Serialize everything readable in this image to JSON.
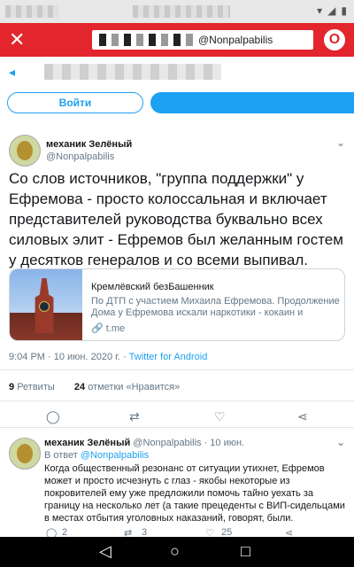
{
  "browser": {
    "url_visible": "@Nonpalpabilis",
    "close_icon": "close-icon",
    "menu_icon": "opera-icon"
  },
  "header": {
    "login_label": "Войти"
  },
  "tweet": {
    "author_name": "механик Зелёный",
    "author_handle": "@Nonpalpabilis",
    "text": "Со слов источников, \"группа поддержки\" у Ефремова  - просто колоссальная и включает представителей руководства буквально всех силовых элит - Ефремов был желанным гостем у десятков генералов и со всеми выпивал.",
    "card": {
      "title": "Кремлёвский безБашенник",
      "description": "По ДТП с участием Михаила Ефремова. Продолжение Дома у Ефремова искали наркотики - кокаин и марихуану...",
      "domain": "t.me"
    },
    "time": "9:04 PM · 10 июн. 2020 г.",
    "source": "Twitter for Android",
    "retweets_count": "9",
    "retweets_label": "Ретвиты",
    "likes_count": "24",
    "likes_label": "отметки «Нравится»"
  },
  "reply": {
    "author_name": "механик Зелёный",
    "author_handle": "@Nonpalpabilis",
    "date": "· 10 июн.",
    "reply_to_prefix": "В ответ",
    "reply_to_handle": "@Nonpalpabilis",
    "text": "Когда общественный резонанс от ситуации утихнет, Ефремов может и просто исчезнуть с глаз - якобы некоторые из покровителей ему уже предложили помочь тайно уехать за границу на несколько лет (а такие прецеденты с ВИП-сидельцами в местах отбытия уголовных наказаний, говорят, были.",
    "replies": "2",
    "retweets": "3",
    "likes": "25"
  },
  "colors": {
    "browser_bar": "#e3252d",
    "accent": "#1da1f2",
    "secondary_text": "#657786"
  }
}
